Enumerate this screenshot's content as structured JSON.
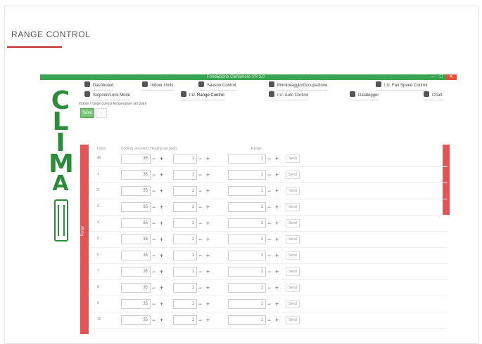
{
  "card": {
    "title": "RANGE CONTROL"
  },
  "window": {
    "title": "Fondazione Climamore VR 3.0",
    "min": "–",
    "max": "□",
    "close": "✕"
  },
  "logo": {
    "letters": [
      "C",
      "L",
      "I",
      "M",
      "A"
    ]
  },
  "tabs": [
    {
      "label": "Dashboard",
      "icon": "dashboard-icon"
    },
    {
      "label": "Indoor Units",
      "icon": "indoor-units-icon"
    },
    {
      "label": "Season Control",
      "icon": "season-icon"
    },
    {
      "label": "Monitoraggio/Occupazione",
      "icon": "monitor-icon"
    },
    {
      "label": "I.U. Fan Speed Control",
      "icon": "fan-icon"
    },
    {
      "label": "Setpoint/Lock Mode",
      "icon": "lock-icon"
    },
    {
      "label": "I.U. Range Control",
      "icon": "range-icon",
      "active": true
    },
    {
      "label": "I.U. Auto Control",
      "icon": "home-icon"
    },
    {
      "label": "Datalogger",
      "icon": "datalogger-icon"
    },
    {
      "label": "Chart",
      "icon": "chart-icon"
    }
  ],
  "breadcrumb": "Indoor / range control temperature set point",
  "buttons": {
    "save": "Save",
    "other": "·"
  },
  "panel": {
    "side_label": "Range"
  },
  "headers": {
    "index": "Index",
    "cooling": "Cooling set point / Heating set point",
    "range": "Range"
  },
  "rows": [
    {
      "label": "All",
      "v1": "35",
      "v2": "1",
      "v3": "1",
      "tag": "Send"
    },
    {
      "label": "1",
      "v1": "35",
      "v2": "1",
      "v3": "1",
      "tag": "Send"
    },
    {
      "label": "2",
      "v1": "35",
      "v2": "1",
      "v3": "1",
      "tag": "Send"
    },
    {
      "label": "3",
      "v1": "35",
      "v2": "1",
      "v3": "1",
      "tag": "Send"
    },
    {
      "label": "4",
      "v1": "35",
      "v2": "1",
      "v3": "1",
      "tag": "Send"
    },
    {
      "label": "5",
      "v1": "35",
      "v2": "1",
      "v3": "1",
      "tag": "Send"
    },
    {
      "label": "6",
      "v1": "35",
      "v2": "1",
      "v3": "1",
      "tag": "Send"
    },
    {
      "label": "7",
      "v1": "35",
      "v2": "1",
      "v3": "1",
      "tag": "Send"
    },
    {
      "label": "8",
      "v1": "35",
      "v2": "1",
      "v3": "1",
      "tag": "Send"
    },
    {
      "label": "9",
      "v1": "35",
      "v2": "1",
      "v3": "1",
      "tag": "Send"
    },
    {
      "label": "10",
      "v1": "35",
      "v2": "1",
      "v3": "1",
      "tag": "Send"
    }
  ],
  "colors": {
    "accent_red": "#c62828",
    "window_green": "#3aa34f",
    "logo_green": "#2e8b3b",
    "panel_red": "#e05555"
  }
}
